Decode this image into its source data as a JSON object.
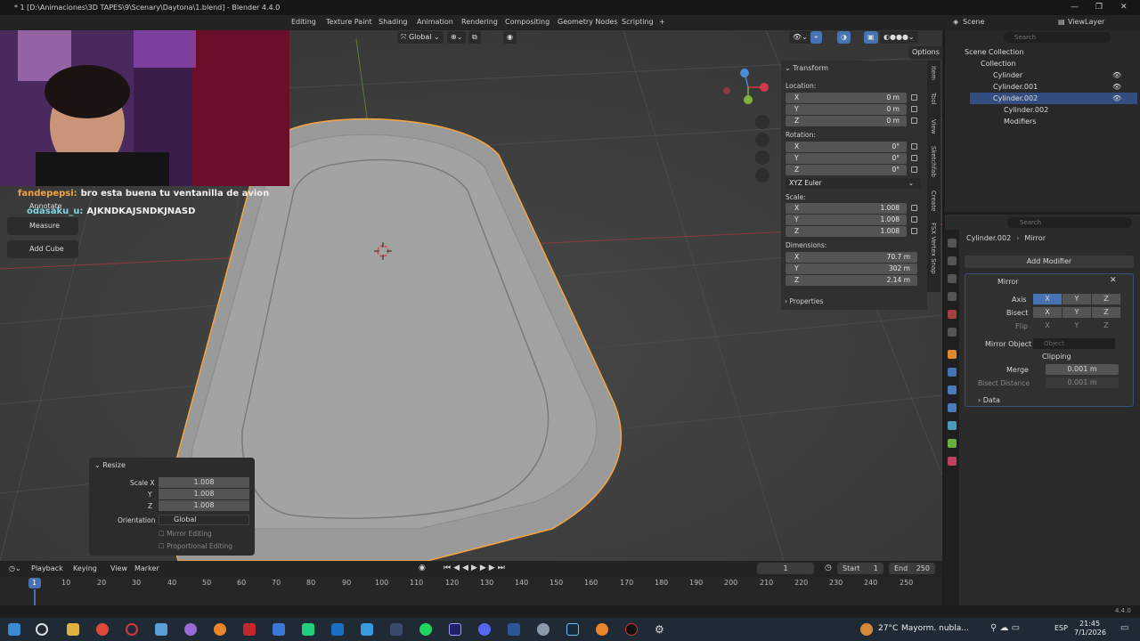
{
  "window": {
    "title": "* 1 [D:\\Animaciones\\3D TAPES\\9\\Scenary\\Daytona\\1.blend] - Blender 4.4.0"
  },
  "workspaces": [
    "Editing",
    "Texture Paint",
    "Shading",
    "Animation",
    "Rendering",
    "Compositing",
    "Geometry Nodes",
    "Scripting"
  ],
  "scene": {
    "name": "Scene",
    "view_layer": "ViewLayer"
  },
  "viewport_header": {
    "orientation": "Global",
    "options": "Options"
  },
  "chat": {
    "line1_user": "fandepepsi:",
    "line1_text": "bro esta buena tu ventanilla de avion",
    "line2_user": "odasaku_u:",
    "line2_text": "AJKNDKAJSNDKJNASD"
  },
  "tools": {
    "annotate": "Annotate",
    "measure": "Measure",
    "add_cube": "Add Cube"
  },
  "npanel": {
    "section": "Transform",
    "location_label": "Location:",
    "location": [
      {
        "axis": "X",
        "value": "0 m"
      },
      {
        "axis": "Y",
        "value": "0 m"
      },
      {
        "axis": "Z",
        "value": "0 m"
      }
    ],
    "rotation_label": "Rotation:",
    "rotation": [
      {
        "axis": "X",
        "value": "0°"
      },
      {
        "axis": "Y",
        "value": "0°"
      },
      {
        "axis": "Z",
        "value": "0°"
      }
    ],
    "rotation_mode": "XYZ Euler",
    "scale_label": "Scale:",
    "scale": [
      {
        "axis": "X",
        "value": "1.008"
      },
      {
        "axis": "Y",
        "value": "1.008"
      },
      {
        "axis": "Z",
        "value": "1.008"
      }
    ],
    "dimensions_label": "Dimensions:",
    "dimensions": [
      {
        "axis": "X",
        "value": "70.7 m"
      },
      {
        "axis": "Y",
        "value": "302 m"
      },
      {
        "axis": "Z",
        "value": "2.14 m"
      }
    ],
    "properties": "Properties",
    "tabs": [
      "Item",
      "Tool",
      "View",
      "Sketchfab",
      "Create",
      "FSX Vertex Snap"
    ]
  },
  "outliner": {
    "search_placeholder": "Search",
    "scene_collection": "Scene Collection",
    "collection": "Collection",
    "items": [
      "Cylinder",
      "Cylinder.001",
      "Cylinder.002"
    ],
    "child_mesh": "Cylinder.002",
    "modifiers": "Modifiers"
  },
  "properties": {
    "search_placeholder": "Search",
    "breadcrumb_object": "Cylinder.002",
    "breadcrumb_modifier": "Mirror",
    "add_modifier": "Add Modifier",
    "modifier_name": "Mirror",
    "axis_label": "Axis",
    "bisect_label": "Bisect",
    "flip_label": "Flip",
    "xyz": [
      "X",
      "Y",
      "Z"
    ],
    "mirror_object_label": "Mirror Object",
    "mirror_object_placeholder": "Object",
    "clipping": "Clipping",
    "merge_label": "Merge",
    "merge_value": "0.001 m",
    "bisect_distance_label": "Bisect Distance",
    "bisect_distance_value": "0.001 m",
    "data": "Data"
  },
  "resize_panel": {
    "title": "Resize",
    "scale_x_label": "Scale X",
    "scale_x": "1.008",
    "y_label": "Y",
    "y": "1.008",
    "z_label": "Z",
    "z": "1.008",
    "orientation_label": "Orientation",
    "orientation": "Global",
    "mirror_editing": "Mirror Editing",
    "proportional_editing": "Proportional Editing"
  },
  "timeline": {
    "menus": [
      "Playback",
      "Keying",
      "View",
      "Marker"
    ],
    "current_frame": "1",
    "start_label": "Start",
    "start": "1",
    "end_label": "End",
    "end": "250",
    "ticks": [
      "1",
      "10",
      "20",
      "30",
      "40",
      "50",
      "60",
      "70",
      "80",
      "90",
      "100",
      "110",
      "120",
      "130",
      "140",
      "150",
      "160",
      "170",
      "180",
      "190",
      "200",
      "210",
      "220",
      "230",
      "240",
      "250"
    ]
  },
  "status": {
    "version": "4.4.0"
  },
  "taskbar": {
    "weather": "27°C",
    "weather_text": "Mayorm. nubla...",
    "lang": "ESP",
    "time": "21:45",
    "date": "7/1/2026"
  },
  "colors": {
    "accent": "#4772b3",
    "selection": "#f5a442",
    "x_axis": "#d2394a",
    "y_axis": "#7fb23a"
  }
}
